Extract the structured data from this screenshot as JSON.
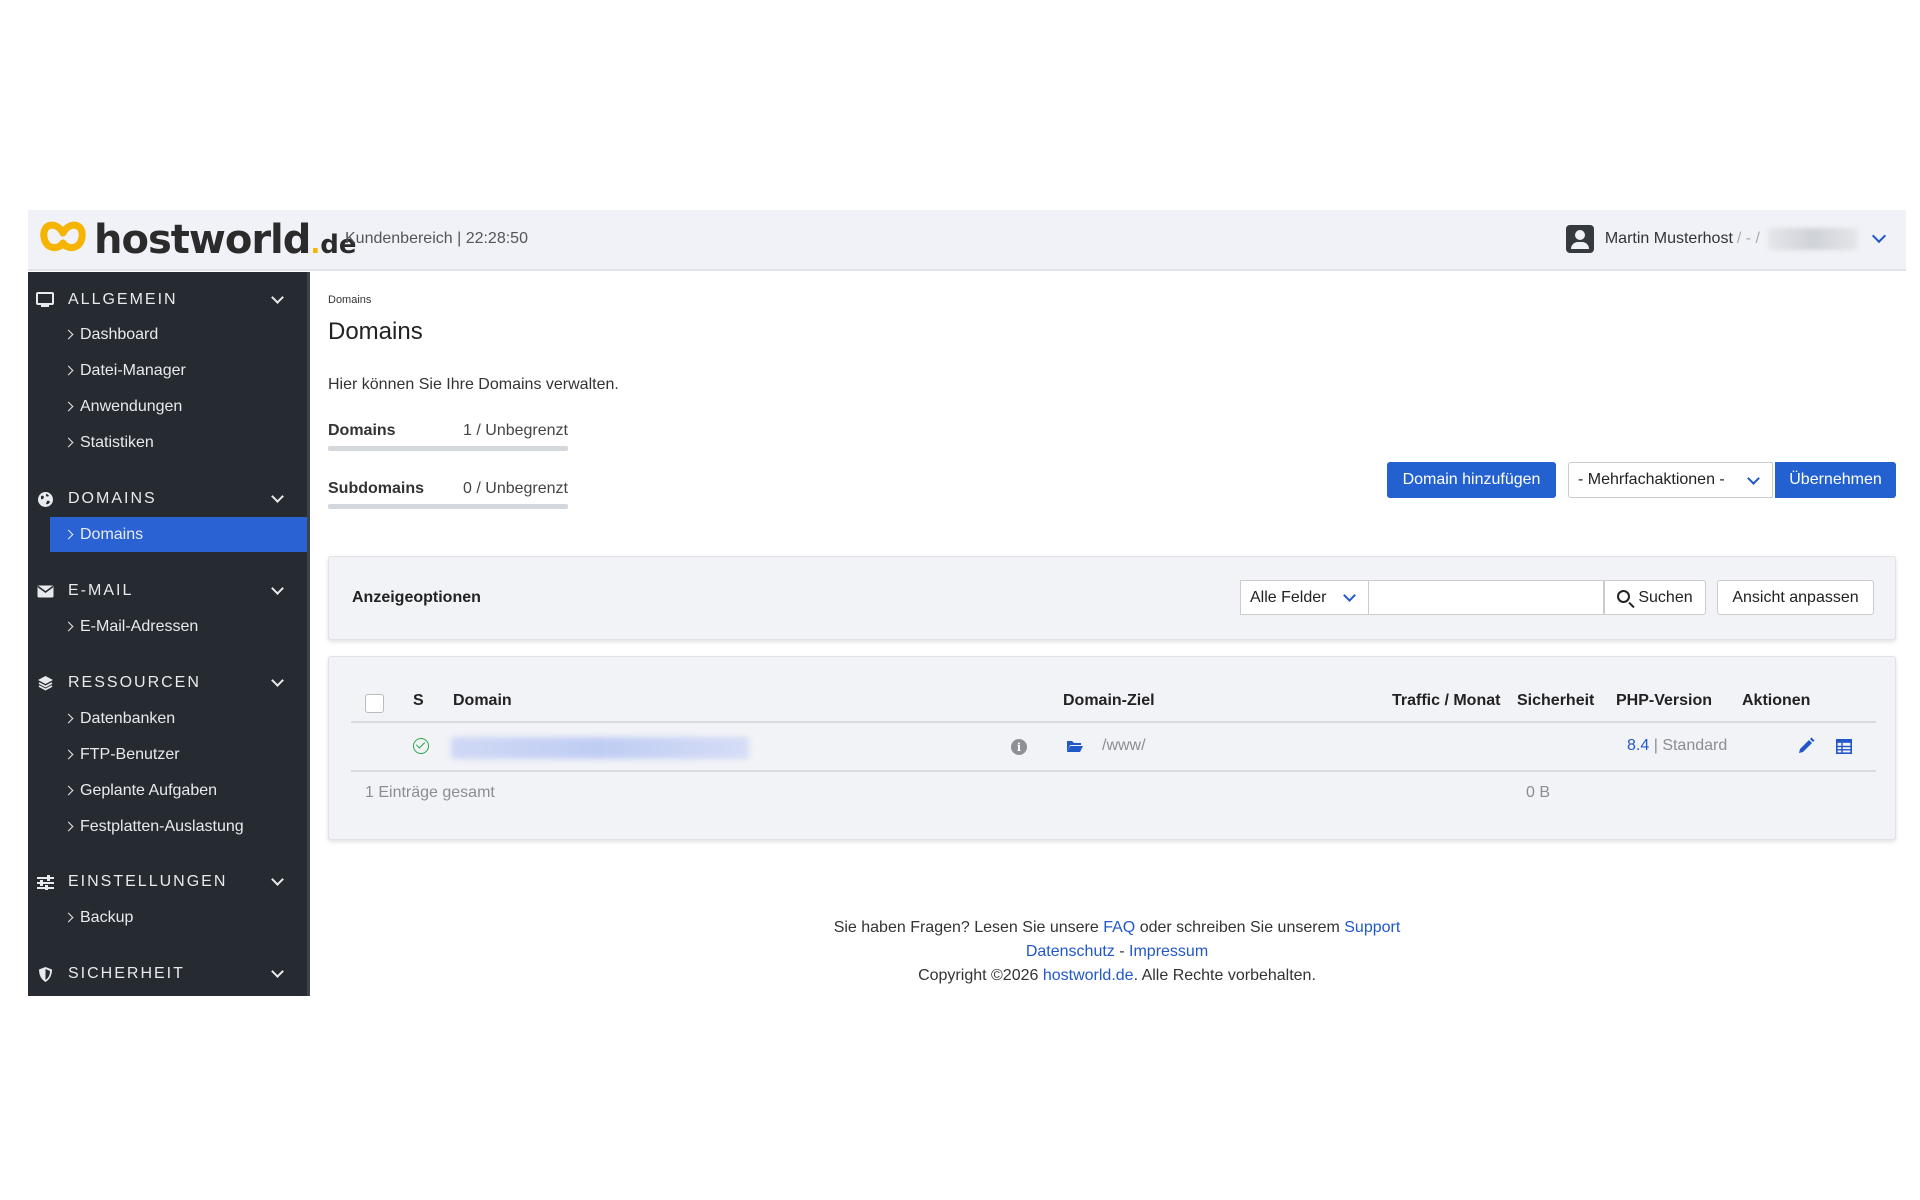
{
  "header": {
    "logo_text": "hostworld",
    "logo_tld": "de",
    "area_label": "Kundenbereich | 22:28:50",
    "user_name": "Martin Musterhost",
    "user_sep": "/ - /"
  },
  "sidebar": {
    "sections": [
      {
        "label": "ALLGEMEIN",
        "icon": "monitor-icon",
        "items": [
          "Dashboard",
          "Datei-Manager",
          "Anwendungen",
          "Statistiken"
        ]
      },
      {
        "label": "DOMAINS",
        "icon": "globe-icon",
        "items": [
          "Domains"
        ]
      },
      {
        "label": "E-MAIL",
        "icon": "envelope-icon",
        "items": [
          "E-Mail-Adressen"
        ]
      },
      {
        "label": "RESSOURCEN",
        "icon": "layers-icon",
        "items": [
          "Datenbanken",
          "FTP-Benutzer",
          "Geplante Aufgaben",
          "Festplatten-Auslastung"
        ]
      },
      {
        "label": "EINSTELLUNGEN",
        "icon": "sliders-icon",
        "items": [
          "Backup"
        ]
      },
      {
        "label": "SICHERHEIT",
        "icon": "shield-icon",
        "items": []
      }
    ],
    "active_item": "Domains"
  },
  "main": {
    "breadcrumb": "Domains",
    "title": "Domains",
    "intro": "Hier können Sie Ihre Domains verwalten.",
    "quotas": [
      {
        "name": "Domains",
        "value": "1 / Unbegrenzt"
      },
      {
        "name": "Subdomains",
        "value": "0 / Unbegrenzt"
      }
    ],
    "add_button": "Domain hinzufügen",
    "bulk_select": "- Mehrfachaktionen -",
    "apply_button": "Übernehmen"
  },
  "options": {
    "title": "Anzeigeoptionen",
    "field_select": "Alle Felder",
    "search_placeholder": "",
    "search_button": "Suchen",
    "view_button": "Ansicht anpassen"
  },
  "table": {
    "headers": {
      "s": "S",
      "domain": "Domain",
      "target": "Domain-Ziel",
      "traffic": "Traffic / Monat",
      "security": "Sicherheit",
      "php": "PHP-Version",
      "actions": "Aktionen"
    },
    "rows": [
      {
        "status": "ok",
        "domain": "",
        "target": "/www/",
        "traffic": "",
        "security": "",
        "php_version": "8.4",
        "php_sep": "|",
        "php_mode": "Standard"
      }
    ],
    "summary": "1 Einträge gesamt",
    "traffic_total": "0 B"
  },
  "footer": {
    "line1_prefix": "Sie haben Fragen? Lesen Sie unsere",
    "faq": "FAQ",
    "line1_mid": "oder schreiben Sie unserem",
    "support": "Support",
    "privacy": "Datenschutz",
    "dash": "-",
    "imprint": "Impressum",
    "copyright_prefix": "Copyright ©2026",
    "site": "hostworld.de",
    "copyright_suffix": ". Alle Rechte vorbehalten."
  },
  "colors": {
    "accent": "#2361d0",
    "sidebar_bg": "#262a31",
    "logo_yellow": "#f4b400",
    "success": "#28a745"
  }
}
